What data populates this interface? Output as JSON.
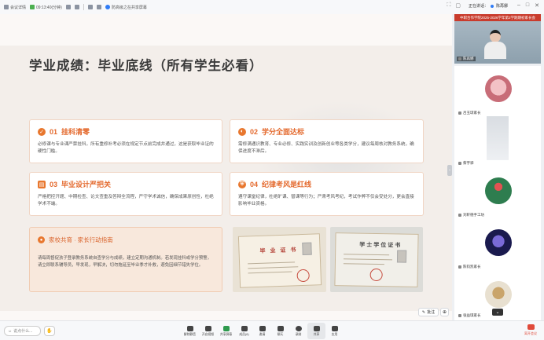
{
  "topbar": {
    "items": [
      "会议详情",
      "09:13:40(分钟)",
      "",
      "",
      "",
      "",
      "防高级之在共享屏幕"
    ],
    "speaker_label": "正在讲话：",
    "speaker_name": "陈再娜"
  },
  "slide": {
    "title": "学业成绩：毕业底线（所有学生必看）",
    "cards": [
      {
        "number": "01",
        "title": "挂科清零",
        "body": "必修课与专业课严禁挂科，所有重修补考必须在规定节点前完成并通过，这是获取毕业证的硬性门槛。"
      },
      {
        "number": "02",
        "title": "学分全面达标",
        "body": "需修满通识教育、专业必修、实践实训及创新创业等各类学分，建议每周核对教务系统，确保进度不滞后。"
      },
      {
        "number": "03",
        "title": "毕业设计严把关",
        "body": "严格把控开题、中期检查、论文查重及答辩全流程，严守学术诚信，确保成果原创性，杜绝学术不端。"
      },
      {
        "number": "04",
        "title": "纪律考风是红线",
        "body": "遵守课堂纪律，杜绝旷课、替课等行为；严肃考风考纪，考试作弊不仅会受处分，更会直接影响毕业资格。"
      }
    ],
    "guide": {
      "title": "家校共育 · 家长行动指南",
      "body": "请每周督促孩子登录教务系统自查学分与成绩，建立定期沟通机制。若发现挂科或学分预警，请立即联系辅导员，早发现，早解决，切勿拖延至毕业季才补救，避免因细节错失学位。"
    },
    "cert1": {
      "heading": "毕 业 证 书"
    },
    "cert2": {
      "heading": "学士学位证书"
    }
  },
  "stage_buttons": {
    "annotate": "批注"
  },
  "participants": [
    {
      "name": "陈再娜",
      "banner": "中职合作学院2025-2026学年第2学期期初家长会"
    },
    {
      "name": "吕玉琼家长"
    },
    {
      "name": "蔡宇骅"
    },
    {
      "name": "刘轩德手工坊"
    },
    {
      "name": "陈钧凯家长"
    },
    {
      "name": "张益琪家长"
    }
  ],
  "bottombar": {
    "chat_placeholder": "说点什么...",
    "tools": [
      "解除静音",
      "开启视频",
      "共享屏幕",
      "成员(6)",
      "邀请",
      "聊天",
      "录制",
      "共享",
      "应用"
    ],
    "leave": "离开会议"
  },
  "colors": {
    "accent": "#e46a2e",
    "guide_bg": "#f8e8dc",
    "banner_red": "#c93b2c"
  }
}
